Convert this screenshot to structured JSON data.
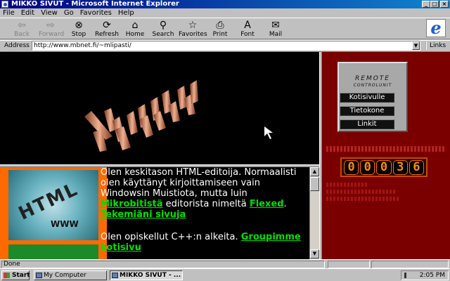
{
  "window": {
    "title": "MIKKO SIVUT - Microsoft Internet Explorer",
    "controls": {
      "minimize": "_",
      "maximize": "□",
      "close": "×"
    }
  },
  "menu": [
    "File",
    "Edit",
    "View",
    "Go",
    "Favorites",
    "Help"
  ],
  "toolbar": [
    {
      "label": "Back",
      "icon": "back-arrow-icon",
      "glyph": "⇦",
      "enabled": false
    },
    {
      "label": "Forward",
      "icon": "forward-arrow-icon",
      "glyph": "⇨",
      "enabled": false
    },
    {
      "label": "Stop",
      "icon": "stop-icon",
      "glyph": "⊗",
      "enabled": true
    },
    {
      "label": "Refresh",
      "icon": "refresh-icon",
      "glyph": "⟳",
      "enabled": true
    },
    {
      "label": "Home",
      "icon": "home-icon",
      "glyph": "⌂",
      "enabled": true
    },
    {
      "label": "Search",
      "icon": "search-icon",
      "glyph": "⚲",
      "enabled": true
    },
    {
      "label": "Favorites",
      "icon": "favorites-icon",
      "glyph": "☆",
      "enabled": true
    },
    {
      "label": "Print",
      "icon": "print-icon",
      "glyph": "⎙",
      "enabled": true
    },
    {
      "label": "Font",
      "icon": "font-icon",
      "glyph": "A",
      "enabled": true
    },
    {
      "label": "Mail",
      "icon": "mail-icon",
      "glyph": "✉",
      "enabled": true
    }
  ],
  "address": {
    "label": "Address",
    "url": "http://www.mbnet.fi/~mlipasti/",
    "links_label": "Links"
  },
  "banner": {
    "logo_text": "MIKKO"
  },
  "main_text": {
    "p1_a": "Olen keskitason HTML-editoija. Normaalisti olen käyttänyt kirjoittamiseen vain Windowsin Muistiota, mutta luin ",
    "p1_link1": "Mikrobitistä",
    "p1_b": " editorista nimeltä ",
    "p1_link2": "Flexed",
    "p1_c": ". ",
    "p1_link3": "Tekemiäni sivuja",
    "p2_a": "Olen opiskellut C++:n alkeita. ",
    "p2_link": "Groupimme kotisivu",
    "html_image_word": "HTML",
    "html_image_www": "WWW"
  },
  "remote": {
    "title": "REMOTE",
    "subtitle": "CONTROLUNIT",
    "buttons": [
      "Kotisivulle",
      "Tietokone",
      "Linkit"
    ]
  },
  "counter": {
    "digits": [
      "0",
      "0",
      "0",
      "3",
      "6"
    ]
  },
  "status": {
    "text": "Done"
  },
  "taskbar": {
    "start": "Start",
    "tasks": [
      "My Computer",
      "MIKKO SIVUT - ..."
    ],
    "clock": "2:05 PM"
  },
  "colors": {
    "title_bar": "#000080",
    "link_green": "#00e000",
    "right_frame": "#7a0000",
    "counter_digit": "#ff8c00"
  }
}
